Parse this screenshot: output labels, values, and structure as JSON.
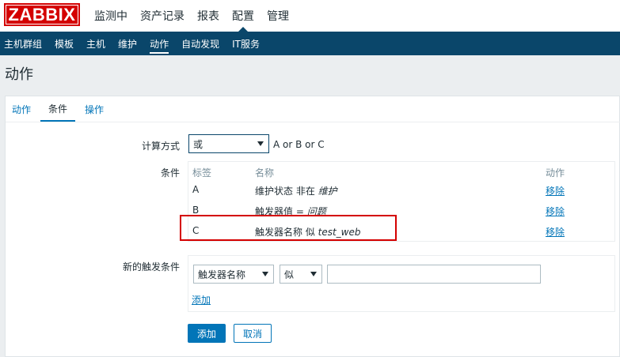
{
  "logo": {
    "text": "ZABBIX"
  },
  "top_menu": [
    {
      "label": "监测中"
    },
    {
      "label": "资产记录"
    },
    {
      "label": "报表"
    },
    {
      "label": "配置",
      "active": true
    },
    {
      "label": "管理"
    }
  ],
  "sub_menu": [
    {
      "label": "主机群组"
    },
    {
      "label": "模板"
    },
    {
      "label": "主机"
    },
    {
      "label": "维护"
    },
    {
      "label": "动作",
      "active": true
    },
    {
      "label": "自动发现"
    },
    {
      "label": "IT服务"
    }
  ],
  "page_title": "动作",
  "tabs": [
    {
      "label": "动作"
    },
    {
      "label": "条件",
      "active": true
    },
    {
      "label": "操作"
    }
  ],
  "form": {
    "calc_label": "计算方式",
    "calc_value": "或",
    "calc_hint": "A or B or C",
    "conditions_label": "条件",
    "table_headers": {
      "tag": "标签",
      "name": "名称",
      "action": "动作"
    },
    "conditions": [
      {
        "tag": "A",
        "name_prefix": "维护状态 非在 ",
        "name_italic": "维护",
        "action": "移除"
      },
      {
        "tag": "B",
        "name_prefix": "触发器值 = ",
        "name_italic": "问题",
        "action": "移除"
      },
      {
        "tag": "C",
        "name_prefix": "触发器名称 似 ",
        "name_italic": "test_web",
        "action": "移除"
      }
    ],
    "new_condition_label": "新的触发条件",
    "new_condition_type": "触发器名称",
    "new_condition_operator": "似",
    "new_condition_value": "",
    "add_link": "添加",
    "submit_button": "添加",
    "cancel_button": "取消"
  },
  "colors": {
    "brand_red": "#d40000",
    "nav_dark": "#0a466a",
    "link_blue": "#0275b8",
    "highlight_box": "#d40000"
  }
}
